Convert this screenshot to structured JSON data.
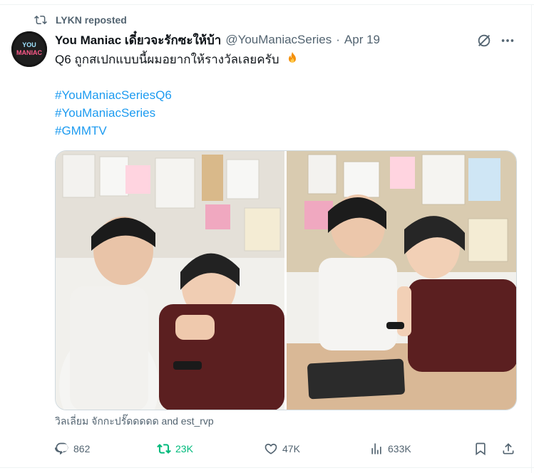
{
  "repost_banner": {
    "text": "LYKN reposted",
    "icon": "repost-icon"
  },
  "tweet": {
    "author": {
      "display_name": "You Maniac เดี๋ยวจะรักซะให้บ้า",
      "handle": "@YouManiacSeries",
      "avatar_text": "YOU MANIAC"
    },
    "separator": "·",
    "date": "Apr 19",
    "text": "Q6 ถูกสเปกแบบนี้ผมอยากให้รางวัลเลยครับ",
    "text_emoji": "fire-emoji",
    "hashtags": [
      "#YouManiacSeriesQ6",
      "#YouManiacSeries",
      "#GMMTV"
    ],
    "tagged_people": "วิลเลี่ยม จักกะปรั๊ดดดดด and est_rvp"
  },
  "actions": {
    "replies": "862",
    "reposts": "23K",
    "likes": "47K",
    "views": "633K"
  },
  "colors": {
    "accent_link": "#1d9bf0",
    "repost_active": "#00ba7c",
    "muted_text": "#536471",
    "primary_text": "#0f1419"
  }
}
